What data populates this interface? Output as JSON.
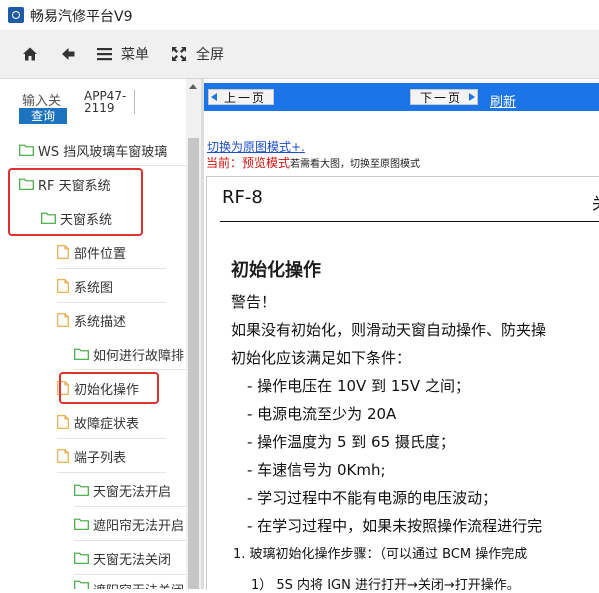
{
  "window": {
    "title": "畅易汽修平台V9"
  },
  "toolbar": {
    "menu_label": "菜单",
    "fullscreen_label": "全屏"
  },
  "search": {
    "label": "输入关",
    "button": "查询",
    "code": "APP47-2119"
  },
  "tree": {
    "ws": "WS 挡风玻璃车窗玻璃",
    "rf": "RF 天窗系统",
    "sunroof": "天窗系统",
    "part_loc": "部件位置",
    "system_diagram": "系统图",
    "system_desc": "系统描述",
    "troubleshoot": "如何进行故障排",
    "init_op": "初始化操作",
    "fault_table": "故障症状表",
    "terminal_list": "端子列表",
    "no_open": "天窗无法开启",
    "shade_no_open": "遮阳帘无法开启",
    "no_close": "天窗无法关闭",
    "partial": "遮阳帘无法关闭"
  },
  "nav": {
    "prev": "上一页",
    "next": "下一页",
    "refresh": "刷新"
  },
  "doc_links": {
    "switch_mode": "切换为原图模式+.",
    "current_prefix": "当前：预览模式",
    "current_note": "若需看大图，切换至原图模式"
  },
  "doc": {
    "page_id": "RF-8",
    "heading": "初始化操作",
    "warning": "警告！",
    "line1": "如果没有初始化，则滑动天窗自动操作、防夹操",
    "line2": "初始化应该满足如下条件：",
    "line3": "- 操作电压在 10V 到 15V 之间；",
    "line4": "- 电源电流至少为 20A",
    "line5": "- 操作温度为 5 到 65 摄氏度；",
    "line6": "- 车速信号为 0Kmh;",
    "line7": "- 学习过程中不能有电源的电压波动；",
    "line8": "- 在学习过程中，如果未按照操作流程进行完",
    "step1": "1.    玻璃初始化操作步骤：（可以通过 BCM 操作完成",
    "step1a": "1）  5S 内将 IGN 进行打开→关闭→打开操作。"
  },
  "colors": {
    "nav_bar": "#1b74e8",
    "highlight_box": "#e03131",
    "query_button": "#1e73be",
    "warning_text": "#d01010"
  }
}
